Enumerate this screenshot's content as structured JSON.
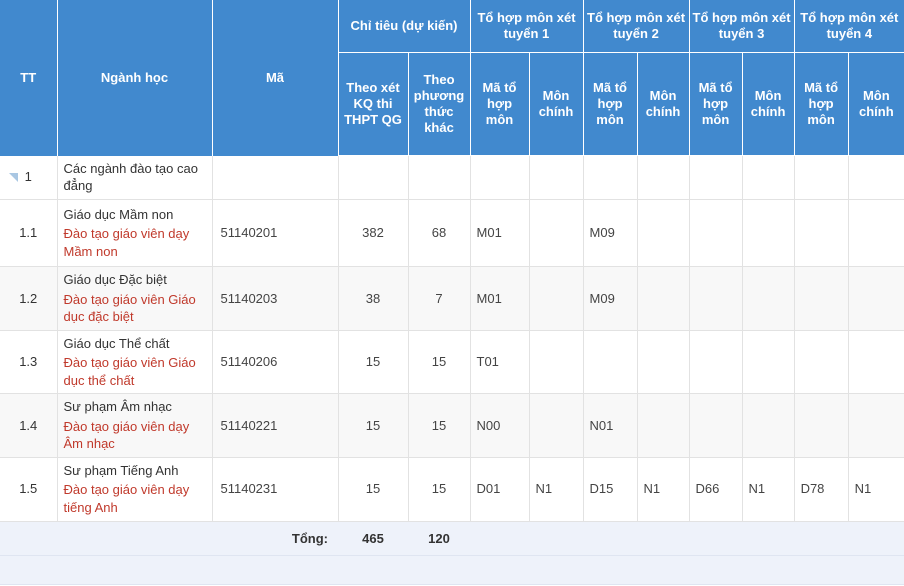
{
  "table": {
    "header": {
      "tt": "TT",
      "nganh_hoc": "Ngành học",
      "ma": "Mã",
      "chi_tieu_group": "Chỉ tiêu (dự kiến)",
      "theo_xet_kq": "Theo xét KQ thi THPT QG",
      "theo_phuong_thuc_khac": "Theo phương thức khác",
      "to_hop_1": "Tổ hợp môn xét tuyển 1",
      "to_hop_2": "Tổ hợp môn xét tuyển 2",
      "to_hop_3": "Tổ hợp môn xét tuyển 3",
      "to_hop_4": "Tổ hợp môn xét tuyển 4",
      "ma_to_hop_1": "Mã tổ hợp môn",
      "mon_chinh_1": "Môn chính",
      "ma_to_hop_2": "Mã tổ hợp môn",
      "mon_chinh_2": "Môn chính",
      "ma_to_hop_3": "Mã tổ hợp môn",
      "mon_chinh_3": "Môn chính",
      "ma_to_hop_4": "Mã tổ hợp môn",
      "mon_chinh_4": "Môn chính"
    },
    "rows": [
      {
        "type": "group",
        "expander_icon": "triangle-collapse-icon",
        "tt": "1",
        "name_main": "Các ngành đào tạo cao đẳng",
        "name_sub": "",
        "ma": "",
        "theo_xet_kq": "",
        "theo_khac": "",
        "ma_th_1": "",
        "mon_chinh_1": "",
        "ma_th_2": "",
        "mon_chinh_2": "",
        "ma_th_3": "",
        "mon_chinh_3": "",
        "ma_th_4": "",
        "mon_chinh_4": ""
      },
      {
        "type": "data",
        "tt": "1.1",
        "name_main": "Giáo dục Mầm non",
        "name_sub": "Đào tạo giáo viên dạy Mầm non",
        "ma": "51140201",
        "theo_xet_kq": "382",
        "theo_khac": "68",
        "ma_th_1": "M01",
        "mon_chinh_1": "",
        "ma_th_2": "M09",
        "mon_chinh_2": "",
        "ma_th_3": "",
        "mon_chinh_3": "",
        "ma_th_4": "",
        "mon_chinh_4": ""
      },
      {
        "type": "data",
        "tt": "1.2",
        "name_main": "Giáo dục Đặc biệt",
        "name_sub": "Đào tạo giáo viên Giáo dục đặc biệt",
        "ma": "51140203",
        "theo_xet_kq": "38",
        "theo_khac": "7",
        "ma_th_1": "M01",
        "mon_chinh_1": "",
        "ma_th_2": "M09",
        "mon_chinh_2": "",
        "ma_th_3": "",
        "mon_chinh_3": "",
        "ma_th_4": "",
        "mon_chinh_4": ""
      },
      {
        "type": "data",
        "tt": "1.3",
        "name_main": "Giáo dục Thể chất",
        "name_sub": "Đào tạo giáo viên Giáo dục thể chất",
        "ma": "51140206",
        "theo_xet_kq": "15",
        "theo_khac": "15",
        "ma_th_1": "T01",
        "mon_chinh_1": "",
        "ma_th_2": "",
        "mon_chinh_2": "",
        "ma_th_3": "",
        "mon_chinh_3": "",
        "ma_th_4": "",
        "mon_chinh_4": ""
      },
      {
        "type": "data",
        "tt": "1.4",
        "name_main": "Sư phạm Âm nhạc",
        "name_sub": "Đào tạo giáo viên dạy Âm nhạc",
        "ma": "51140221",
        "theo_xet_kq": "15",
        "theo_khac": "15",
        "ma_th_1": "N00",
        "mon_chinh_1": "",
        "ma_th_2": "N01",
        "mon_chinh_2": "",
        "ma_th_3": "",
        "mon_chinh_3": "",
        "ma_th_4": "",
        "mon_chinh_4": ""
      },
      {
        "type": "data",
        "tt": "1.5",
        "name_main": "Sư phạm Tiếng Anh",
        "name_sub": "Đào tạo giáo viên dạy tiếng Anh",
        "ma": "51140231",
        "theo_xet_kq": "15",
        "theo_khac": "15",
        "ma_th_1": "D01",
        "mon_chinh_1": "N1",
        "ma_th_2": "D15",
        "mon_chinh_2": "N1",
        "ma_th_3": "D66",
        "mon_chinh_3": "N1",
        "ma_th_4": "D78",
        "mon_chinh_4": "N1"
      }
    ],
    "footer": {
      "label": "Tổng:",
      "total_theo_xet_kq": "465",
      "total_theo_khac": "120"
    },
    "colors": {
      "header_background": "#4189ce",
      "header_text": "#ffffff",
      "sub_name_text": "#c0392b",
      "row_alt_background": "#f8f8f8",
      "footer_background": "#eef2fa",
      "grid_line": "#e2e2e2"
    }
  }
}
